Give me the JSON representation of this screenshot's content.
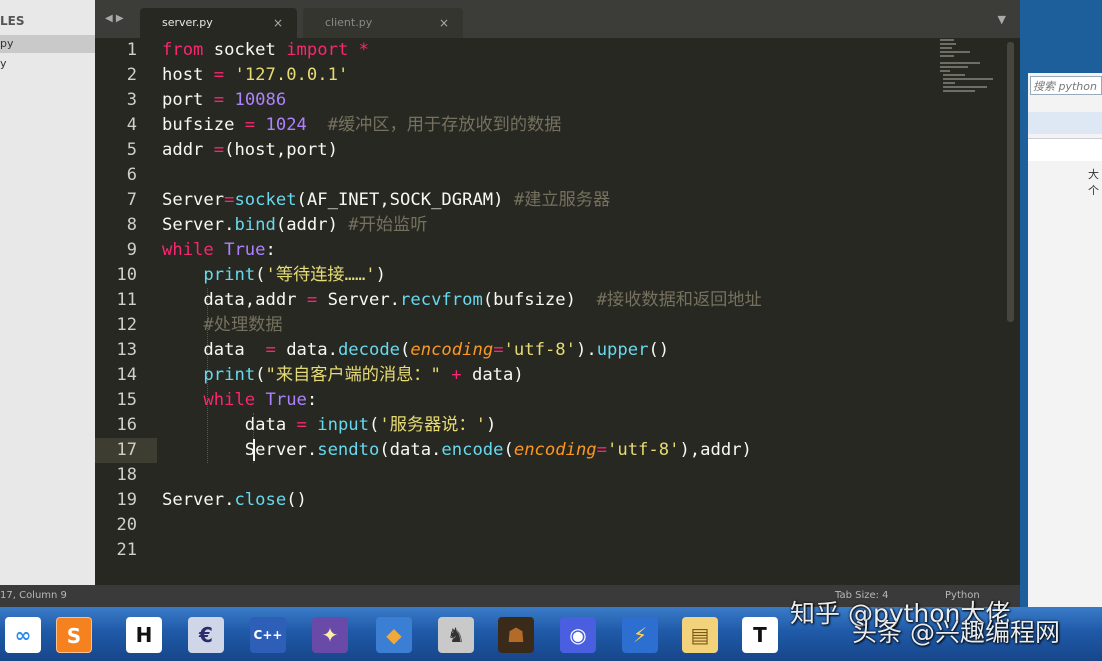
{
  "sidebar": {
    "header": "LES",
    "items": [
      {
        "label": "py",
        "active": true
      },
      {
        "label": "y",
        "active": false
      }
    ]
  },
  "tabbar": {
    "nav": "◀ ▶",
    "tabs": [
      {
        "label": "server.py",
        "close": "×",
        "active": true
      },
      {
        "label": "client.py",
        "close": "×",
        "active": false
      }
    ],
    "menu": "▼"
  },
  "editor": {
    "lines": [
      {
        "no": "1",
        "html": "<span class=\"kw\">from</span> socket <span class=\"kw\">import</span> <span class=\"kw\">*</span>"
      },
      {
        "no": "2",
        "html": "host <span class=\"kw\">=</span> <span class=\"str\">'127.0.0.1'</span>"
      },
      {
        "no": "3",
        "html": "port <span class=\"kw\">=</span> <span class=\"num\">10086</span>"
      },
      {
        "no": "4",
        "html": "bufsize <span class=\"kw\">=</span> <span class=\"num\">1024</span>  <span class=\"cm\">#缓冲区，用于存放收到的数据</span>"
      },
      {
        "no": "5",
        "html": "addr <span class=\"kw\">=</span>(host,port)"
      },
      {
        "no": "6",
        "html": ""
      },
      {
        "no": "7",
        "html": "Server<span class=\"kw\">=</span><span class=\"fn\">socket</span>(AF_INET,SOCK_DGRAM) <span class=\"cm\">#建立服务器</span>"
      },
      {
        "no": "8",
        "html": "Server.<span class=\"fn\">bind</span>(addr) <span class=\"cm\">#开始监听</span>"
      },
      {
        "no": "9",
        "html": "<span class=\"kw\">while</span> <span class=\"const\">True</span>:"
      },
      {
        "no": "10",
        "html": "    <span class=\"fn\">print</span>(<span class=\"str\">'等待连接……'</span>)"
      },
      {
        "no": "11",
        "html": "    data,addr <span class=\"kw\">=</span> Server.<span class=\"fn\">recvfrom</span>(bufsize)  <span class=\"cm\">#接收数据和返回地址</span>"
      },
      {
        "no": "12",
        "html": "    <span class=\"cm\">#处理数据</span>"
      },
      {
        "no": "13",
        "html": "    data  <span class=\"kw\">=</span> data.<span class=\"fn\">decode</span>(<span class=\"param\">encoding</span><span class=\"kw\">=</span><span class=\"str\">'utf-8'</span>).<span class=\"fn\">upper</span>()"
      },
      {
        "no": "14",
        "html": "    <span class=\"fn\">print</span>(<span class=\"str\">\"来自客户端的消息：\"</span> <span class=\"kw\">+</span> data)"
      },
      {
        "no": "15",
        "html": "    <span class=\"kw\">while</span> <span class=\"const\">True</span>:"
      },
      {
        "no": "16",
        "html": "        data <span class=\"kw\">=</span> <span class=\"fn\">input</span>(<span class=\"str\">'服务器说：'</span>)"
      },
      {
        "no": "17",
        "html": "        Server.<span class=\"fn\">sendto</span>(data.<span class=\"fn\">encode</span>(<span class=\"param\">encoding</span><span class=\"kw\">=</span><span class=\"str\">'utf-8'</span>),addr)",
        "current": true
      },
      {
        "no": "18",
        "html": ""
      },
      {
        "no": "19",
        "html": "Server.<span class=\"fn\">close</span>()"
      },
      {
        "no": "20",
        "html": ""
      },
      {
        "no": "21",
        "html": ""
      }
    ]
  },
  "statusbar": {
    "position": "17, Column 9",
    "tab_size": "Tab Size: 4",
    "syntax": "Python"
  },
  "background_window": {
    "search_placeholder": "搜索 python",
    "side_text": "大个"
  },
  "taskbar": {
    "icons": [
      {
        "name": "baidu-netdisk-icon",
        "glyph": "∞",
        "color": "#2a8cf0",
        "bg": "#ffffff"
      },
      {
        "name": "sublime-text-icon",
        "glyph": "S",
        "color": "#ffffff",
        "bg": "#f5811f",
        "active": true
      },
      {
        "name": "hbuilder-icon",
        "glyph": "H",
        "color": "#111111",
        "bg": "#ffffff"
      },
      {
        "name": "eclipse-icon",
        "glyph": "€",
        "color": "#2b2b6e",
        "bg": "#cfd6e8"
      },
      {
        "name": "dev-cpp-icon",
        "glyph": "C++",
        "color": "#ffffff",
        "bg": "#2d5fb8"
      },
      {
        "name": "game-icon",
        "glyph": "✦",
        "color": "#ffeeaa",
        "bg": "#6a4aa8"
      },
      {
        "name": "app-icon",
        "glyph": "◆",
        "color": "#f2a93b",
        "bg": "#3b7fd4"
      },
      {
        "name": "counter-strike-icon",
        "glyph": "♞",
        "color": "#333333",
        "bg": "#c9c9c9"
      },
      {
        "name": "warcraft-icon",
        "glyph": "☗",
        "color": "#b36b2a",
        "bg": "#3a2a1a"
      },
      {
        "name": "browser-icon",
        "glyph": "◉",
        "color": "#ffffff",
        "bg": "#4a5ee0"
      },
      {
        "name": "thunder-icon",
        "glyph": "⚡",
        "color": "#ffd24a",
        "bg": "#2d6fd0"
      },
      {
        "name": "file-explorer-icon",
        "glyph": "▤",
        "color": "#7a5a1a",
        "bg": "#f2d27a"
      },
      {
        "name": "typora-icon",
        "glyph": "T",
        "color": "#111111",
        "bg": "#ffffff"
      }
    ]
  },
  "watermark": {
    "line1": "知乎 @python大佬",
    "line2": "头条 @兴趣编程网"
  },
  "colors": {
    "editor_bg": "#272822",
    "keyword": "#f92672",
    "string": "#e6db74",
    "number": "#ae81ff",
    "function": "#66d9ef",
    "comment": "#75715e",
    "parameter": "#fd971f"
  }
}
